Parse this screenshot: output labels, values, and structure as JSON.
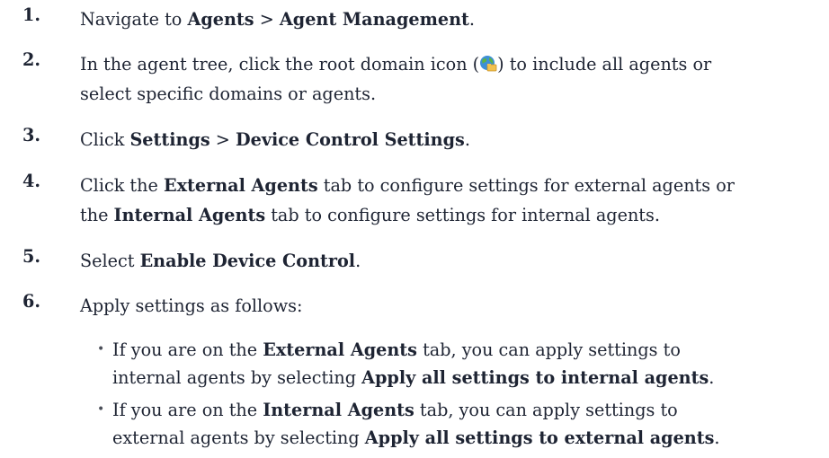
{
  "steps": [
    {
      "num": "1.",
      "parts": [
        "Navigate to ",
        "Agents",
        " > ",
        "Agent Management",
        "."
      ]
    },
    {
      "num": "2.",
      "line1_a": "In the agent tree, click the root domain icon (",
      "icon": "globe-folder-icon",
      "line1_b": ") to include all agents or",
      "line2": "select specific domains or agents."
    },
    {
      "num": "3.",
      "parts": [
        "Click ",
        "Settings",
        " > ",
        "Device Control Settings",
        "."
      ]
    },
    {
      "num": "4.",
      "line1": [
        "Click the ",
        "External Agents",
        " tab to configure settings for external agents or"
      ],
      "line2": [
        "the ",
        "Internal Agents",
        " tab to configure settings for internal agents."
      ]
    },
    {
      "num": "5.",
      "parts": [
        "Select ",
        "Enable Device Control",
        "."
      ]
    },
    {
      "num": "6.",
      "text": "Apply settings as follows:",
      "bullets": [
        {
          "line1": [
            "If you are on the ",
            "External Agents",
            " tab, you can apply settings to"
          ],
          "line2": [
            "internal agents by selecting ",
            "Apply all settings to internal agents",
            "."
          ]
        },
        {
          "line1": [
            "If you are on the ",
            "Internal Agents",
            " tab, you can apply settings to"
          ],
          "line2": [
            "external agents by selecting ",
            "Apply all settings to external agents",
            "."
          ]
        }
      ]
    }
  ],
  "bullet_glyph": "•"
}
